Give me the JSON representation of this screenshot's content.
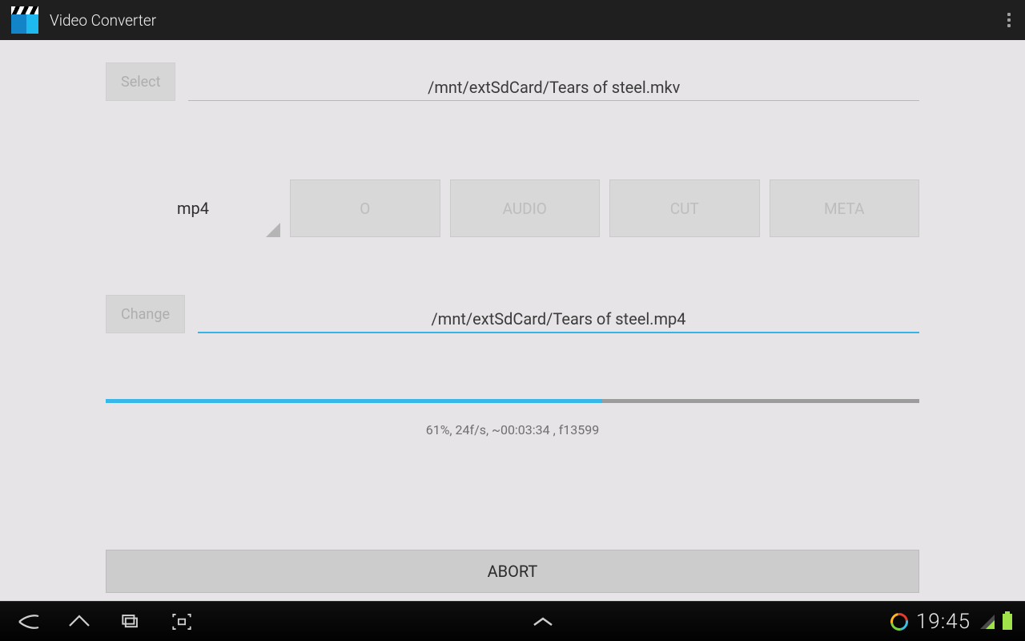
{
  "app": {
    "title": "Video Converter"
  },
  "input": {
    "select_label": "Select",
    "path": "/mnt/extSdCard/Tears of steel.mkv"
  },
  "format": {
    "value": "mp4"
  },
  "options": {
    "o": "O",
    "audio": "AUDIO",
    "cut": "CUT",
    "meta": "META"
  },
  "output": {
    "change_label": "Change",
    "path": "/mnt/extSdCard/Tears of steel.mp4"
  },
  "progress": {
    "percent": 61,
    "status": "61%, 24f/s, ~00:03:34 , f13599"
  },
  "action": {
    "abort": "ABORT"
  },
  "statusbar": {
    "time": "19:45"
  }
}
